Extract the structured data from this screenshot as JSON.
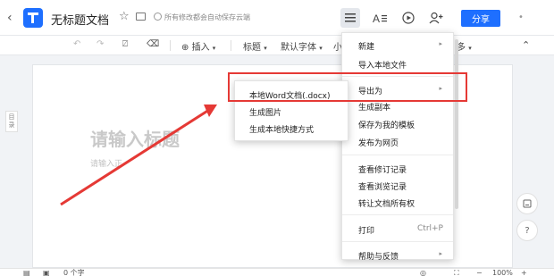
{
  "header": {
    "back_icon": "chevron-left-icon",
    "doc_title": "无标题文档",
    "save_status": "所有修改都会自动保存云端",
    "share_label": "分享",
    "accent_color": "#1e6fff"
  },
  "toolbar": {
    "insert_label": "插入",
    "heading_label": "标题",
    "font_label": "默认字体",
    "size_label": "小",
    "more_label": "多"
  },
  "document": {
    "title_placeholder": "请输入标题",
    "body_placeholder": "请输入正"
  },
  "side_tab": {
    "label": "目录"
  },
  "floating": {
    "help_label": "?"
  },
  "dropdown": {
    "items": [
      {
        "label": "新建",
        "has_submenu": true
      },
      {
        "label": "导入本地文件",
        "has_submenu": false
      },
      {
        "label": "导出为",
        "has_submenu": true
      },
      {
        "label": "生成副本",
        "has_submenu": false
      },
      {
        "label": "保存为我的模板",
        "has_submenu": false
      },
      {
        "label": "发布为网页",
        "has_submenu": false
      },
      {
        "label": "查看修订记录",
        "has_submenu": false
      },
      {
        "label": "查看浏览记录",
        "has_submenu": false
      },
      {
        "label": "转让文档所有权",
        "has_submenu": false
      },
      {
        "label": "打印",
        "shortcut": "Ctrl+P"
      },
      {
        "label": "帮助与反馈",
        "has_submenu": true
      }
    ]
  },
  "export_submenu": {
    "items": [
      {
        "label": "本地Word文档(.docx)"
      },
      {
        "label": "生成图片"
      },
      {
        "label": "生成本地快捷方式"
      }
    ]
  },
  "status": {
    "word_count": "0 个字",
    "zoom": "100%"
  },
  "annotation_color": "#e53935"
}
